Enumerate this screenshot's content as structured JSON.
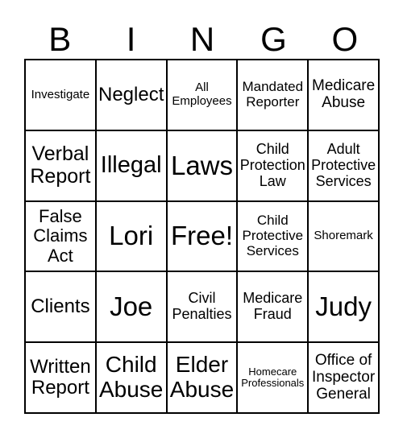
{
  "header": [
    "B",
    "I",
    "N",
    "G",
    "O"
  ],
  "cells": [
    "Investigate",
    "Neglect",
    "All Employees",
    "Mandated Reporter",
    "Medicare Abuse",
    "Verbal Report",
    "Illegal",
    "Laws",
    "Child Protection Law",
    "Adult Protective Services",
    "False Claims Act",
    "Lori",
    "Free!",
    "Child Protective Services",
    "Shoremark",
    "Clients",
    "Joe",
    "Civil Penalties",
    "Medicare Fraud",
    "Judy",
    "Written Report",
    "Child Abuse",
    "Elder Abuse",
    "Homecare Professionals",
    "Office of Inspector General"
  ]
}
